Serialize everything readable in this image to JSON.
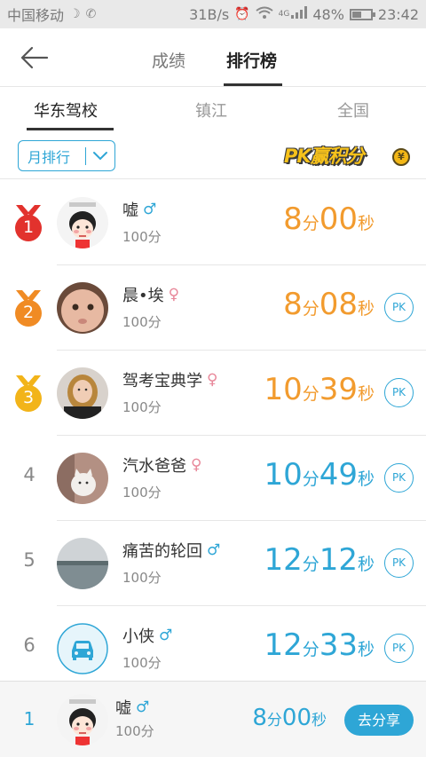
{
  "statusbar": {
    "carrier": "中国移动",
    "speed": "31B/s",
    "network": "4G",
    "battery_text": "48%",
    "battery_level": 0.48,
    "time": "23:42"
  },
  "header": {
    "tabs": [
      {
        "label": "成绩",
        "active": false
      },
      {
        "label": "排行榜",
        "active": true
      }
    ]
  },
  "scope_tabs": [
    {
      "label": "华东驾校",
      "active": true
    },
    {
      "label": "镇江",
      "active": false
    },
    {
      "label": "全国",
      "active": false
    }
  ],
  "filter": {
    "period_label": "月排行",
    "pk_banner": "PK赢积分",
    "pk_coin": "¥"
  },
  "pk_label": "PK",
  "rankings": [
    {
      "rank": "1",
      "medal": "gold-red",
      "name": "嘘",
      "gender": "male",
      "score": "100分",
      "min": "8",
      "min_unit": "分",
      "sec": "00",
      "sec_unit": "秒",
      "color": "orange",
      "pk": false
    },
    {
      "rank": "2",
      "medal": "orange",
      "name": "晨•埃",
      "gender": "female",
      "score": "100分",
      "min": "8",
      "min_unit": "分",
      "sec": "08",
      "sec_unit": "秒",
      "color": "orange",
      "pk": true
    },
    {
      "rank": "3",
      "medal": "yellow",
      "name": "驾考宝典学",
      "gender": "female",
      "score": "100分",
      "min": "10",
      "min_unit": "分",
      "sec": "39",
      "sec_unit": "秒",
      "color": "orange",
      "pk": true
    },
    {
      "rank": "4",
      "medal": null,
      "name": "汽水爸爸",
      "gender": "female",
      "score": "100分",
      "min": "10",
      "min_unit": "分",
      "sec": "49",
      "sec_unit": "秒",
      "color": "blue",
      "pk": true
    },
    {
      "rank": "5",
      "medal": null,
      "name": "痛苦的轮回",
      "gender": "male",
      "score": "100分",
      "min": "12",
      "min_unit": "分",
      "sec": "12",
      "sec_unit": "秒",
      "color": "blue",
      "pk": true
    },
    {
      "rank": "6",
      "medal": null,
      "name": "小侠",
      "gender": "male",
      "score": "100分",
      "min": "12",
      "min_unit": "分",
      "sec": "33",
      "sec_unit": "秒",
      "color": "blue",
      "pk": true
    }
  ],
  "my_rank": {
    "rank": "1",
    "name": "嘘",
    "gender": "male",
    "score": "100分",
    "min": "8",
    "min_unit": "分",
    "sec": "00",
    "sec_unit": "秒",
    "share_label": "去分享"
  },
  "colors": {
    "accent": "#2ea6d6",
    "orange": "#f29b2e",
    "medal_red": "#e2322d",
    "medal_orange": "#f08b24",
    "medal_yellow": "#f2b41a"
  },
  "gender_symbols": {
    "male": "♂",
    "female": "♀"
  }
}
